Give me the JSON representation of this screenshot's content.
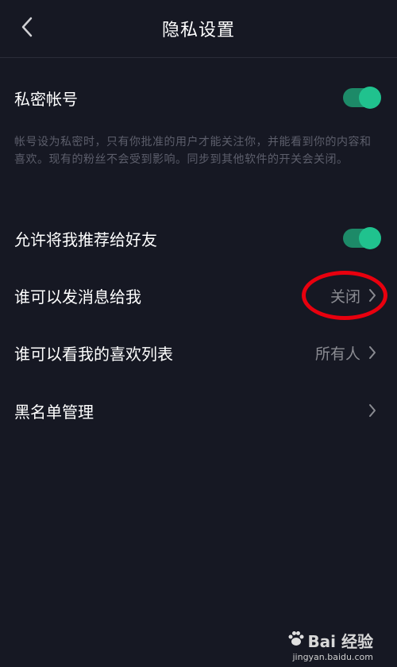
{
  "header": {
    "title": "隐私设置",
    "back_icon": "chevron-left-icon"
  },
  "private_account": {
    "label": "私密帐号",
    "enabled": true
  },
  "private_account_desc": "帐号设为私密时，只有你批准的用户才能关注你，并能看到你的内容和喜欢。现有的粉丝不会受到影响。同步到其他软件的开关会关闭。",
  "recommend_to_friends": {
    "label": "允许将我推荐给好友",
    "enabled": true
  },
  "message_permission": {
    "label": "谁可以发消息给我",
    "value": "关闭"
  },
  "likes_visibility": {
    "label": "谁可以看我的喜欢列表",
    "value": "所有人"
  },
  "blacklist": {
    "label": "黑名单管理"
  },
  "colors": {
    "background": "#161823",
    "accent": "#20c28e",
    "annotation": "#e8000e"
  },
  "watermark": {
    "brand": "Bai 经验",
    "url": "jingyan.baidu.com"
  }
}
